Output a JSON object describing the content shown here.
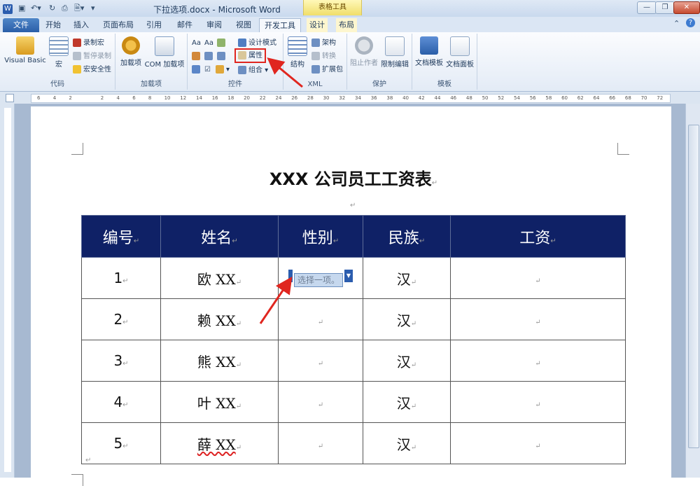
{
  "titlebar": {
    "doc_title": "下拉选项.docx - Microsoft Word",
    "context_tab": "表格工具"
  },
  "tabs": [
    {
      "label": "文件"
    },
    {
      "label": "开始"
    },
    {
      "label": "插入"
    },
    {
      "label": "页面布局"
    },
    {
      "label": "引用"
    },
    {
      "label": "邮件"
    },
    {
      "label": "审阅"
    },
    {
      "label": "视图"
    },
    {
      "label": "开发工具"
    },
    {
      "label": "设计"
    },
    {
      "label": "布局"
    }
  ],
  "ribbon": {
    "code": {
      "label": "代码",
      "visual_basic": "Visual Basic",
      "macros": "宏",
      "record_macro": "录制宏",
      "pause_recording": "暂停录制",
      "macro_security": "宏安全性"
    },
    "addins": {
      "label": "加载项",
      "addins": "加载项",
      "com_addins": "COM 加载项"
    },
    "controls": {
      "label": "控件",
      "design_mode": "设计模式",
      "properties": "属性",
      "group": "组合"
    },
    "xml": {
      "label": "XML",
      "structure": "结构",
      "schema": "架构",
      "transform": "转换",
      "expansion_packs": "扩展包"
    },
    "protect": {
      "label": "保护",
      "block_authors": "阻止作者",
      "restrict_editing": "限制编辑"
    },
    "templates": {
      "label": "模板",
      "document_template": "文档模板",
      "document_panel": "文档面板"
    }
  },
  "ruler": [
    "6",
    "4",
    "2",
    "",
    "2",
    "4",
    "6",
    "8",
    "10",
    "12",
    "14",
    "16",
    "18",
    "20",
    "22",
    "24",
    "26",
    "28",
    "30",
    "32",
    "34",
    "36",
    "38",
    "40",
    "42",
    "44",
    "46",
    "48",
    "50",
    "52",
    "54",
    "56",
    "58",
    "60",
    "62",
    "64",
    "66",
    "68",
    "70",
    "72"
  ],
  "document": {
    "title": "XXX 公司员工工资表",
    "table": {
      "headers": [
        "编号",
        "姓名",
        "性别",
        "民族",
        "工资"
      ],
      "rows": [
        {
          "id": "1",
          "name": "欧 XX",
          "gender": "",
          "ethnicity": "汉",
          "salary": ""
        },
        {
          "id": "2",
          "name": "赖 XX",
          "gender": "",
          "ethnicity": "汉",
          "salary": ""
        },
        {
          "id": "3",
          "name": "熊 XX",
          "gender": "",
          "ethnicity": "汉",
          "salary": ""
        },
        {
          "id": "4",
          "name": "叶 XX",
          "gender": "",
          "ethnicity": "汉",
          "salary": ""
        },
        {
          "id": "5",
          "name": "薛 XX",
          "gender": "",
          "ethnicity": "汉",
          "salary": ""
        }
      ],
      "dropdown_placeholder": "选择一项。"
    }
  },
  "colors": {
    "header_fill": "#0f2166",
    "highlight_box": "#e0261f"
  }
}
